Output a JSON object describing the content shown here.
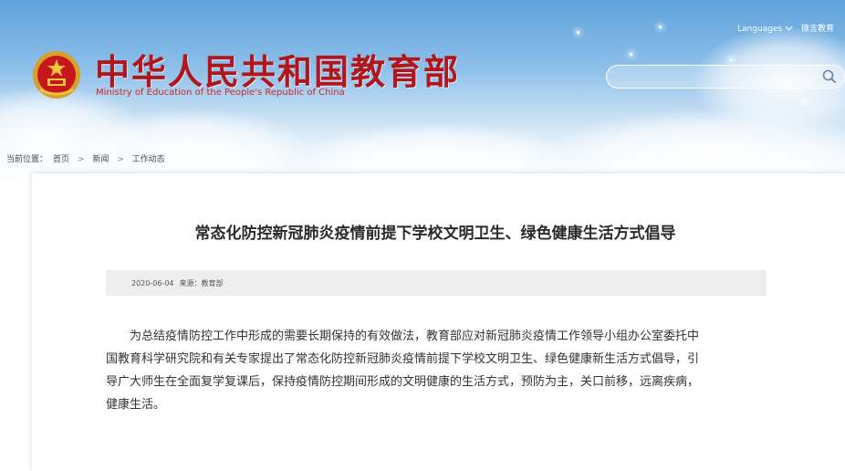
{
  "header": {
    "title_cn": "中华人民共和国教育部",
    "title_en": "Ministry of Education of the People's Republic of China",
    "languages_label": "Languages",
    "weibo_label": "微言教育",
    "search_placeholder": ""
  },
  "breadcrumb": {
    "prefix": "当前位置：",
    "items": [
      "首页",
      "新闻",
      "工作动态"
    ],
    "separator": ">"
  },
  "article": {
    "title": "常态化防控新冠肺炎疫情前提下学校文明卫生、绿色健康生活方式倡导",
    "date": "2020-06-04",
    "source_label": "来源：",
    "source": "教育部",
    "body_lines": [
      "为总结疫情防控工作中形成的需要长期保持的有效做法，教育部应对新冠肺炎疫情工作领导小组办公室委托中",
      "国教育科学研究院和有关专家提出了常态化防控新冠肺炎疫情前提下学校文明卫生、绿色健康新生活方式倡导，引",
      "导广大师生在全面复学复课后，保持疫情防控期间形成的文明健康的生活方式，预防为主，关口前移，远离疾病，",
      "健康生活。"
    ]
  },
  "colors": {
    "title_red": "#b0161b",
    "sky_blue": "#5fa2dc",
    "meta_bg": "#eeeeee"
  },
  "icons": {
    "emblem": "national-emblem-icon",
    "search": "search-icon",
    "dropdown": "chevron-down-icon"
  }
}
